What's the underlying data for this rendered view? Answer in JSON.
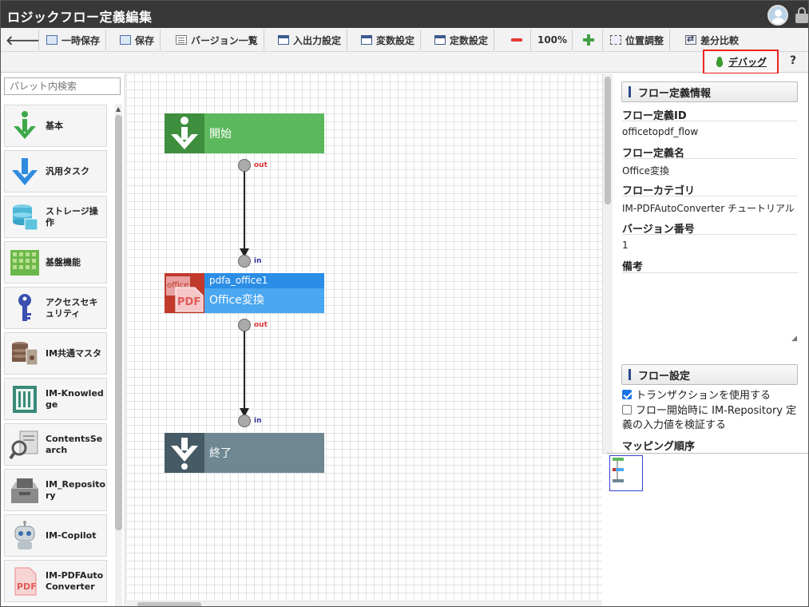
{
  "window": {
    "title": "ロジックフロー定義編集"
  },
  "toolbar": {
    "temp_save": "一時保存",
    "save": "保存",
    "versions": "バージョン一覧",
    "io_settings": "入出力設定",
    "var_settings": "変数設定",
    "const_settings": "定数設定",
    "zoom": "100%",
    "position": "位置調整",
    "diff": "差分比較",
    "debug": "デバッグ",
    "help": "?"
  },
  "palette": {
    "search_placeholder": "パレット内検索",
    "items": [
      {
        "label": "基本",
        "icon": "arrow-down-green-icon"
      },
      {
        "label": "汎用タスク",
        "icon": "arrow-down-blue-icon"
      },
      {
        "label": "ストレージ操作",
        "icon": "storage-icon"
      },
      {
        "label": "基盤機能",
        "icon": "grid-icon"
      },
      {
        "label": "アクセスセキュリティ",
        "icon": "key-icon"
      },
      {
        "label": "IM共通マスタ",
        "icon": "master-icon"
      },
      {
        "label": "IM-Knowledge",
        "icon": "knowledge-icon"
      },
      {
        "label": "ContentsSearch",
        "icon": "search-doc-icon"
      },
      {
        "label": "IM_Repository",
        "icon": "repository-icon"
      },
      {
        "label": "IM-Copilot",
        "icon": "robot-icon"
      },
      {
        "label": "IM-PDFAutoConverter",
        "icon": "pdf-icon"
      }
    ]
  },
  "flow": {
    "start": {
      "label": "開始",
      "out": "out"
    },
    "task": {
      "id": "pdfa_office1",
      "label": "Office変換",
      "in": "in",
      "out": "out"
    },
    "end": {
      "label": "終了",
      "in": "in"
    }
  },
  "props": {
    "section_info": "フロー定義情報",
    "id_label": "フロー定義ID",
    "id_value": "officetopdf_flow",
    "name_label": "フロー定義名",
    "name_value": "Office変換",
    "category_label": "フローカテゴリ",
    "category_value": "IM-PDFAutoConverter チュートリアル",
    "version_label": "バージョン番号",
    "version_value": "1",
    "note_label": "備考",
    "section_settings": "フロー設定",
    "transaction_label": "トランザクションを使用する",
    "transaction_checked": true,
    "validate_label": "フロー開始時に IM-Repository 定義の入力値を検証する",
    "validate_checked": false,
    "mapping_label": "マッピング順序"
  },
  "colors": {
    "start_green": "#5cb85c",
    "task_blue": "#3d9be9",
    "end_gray": "#6e8792",
    "debug_border": "#e22222"
  }
}
